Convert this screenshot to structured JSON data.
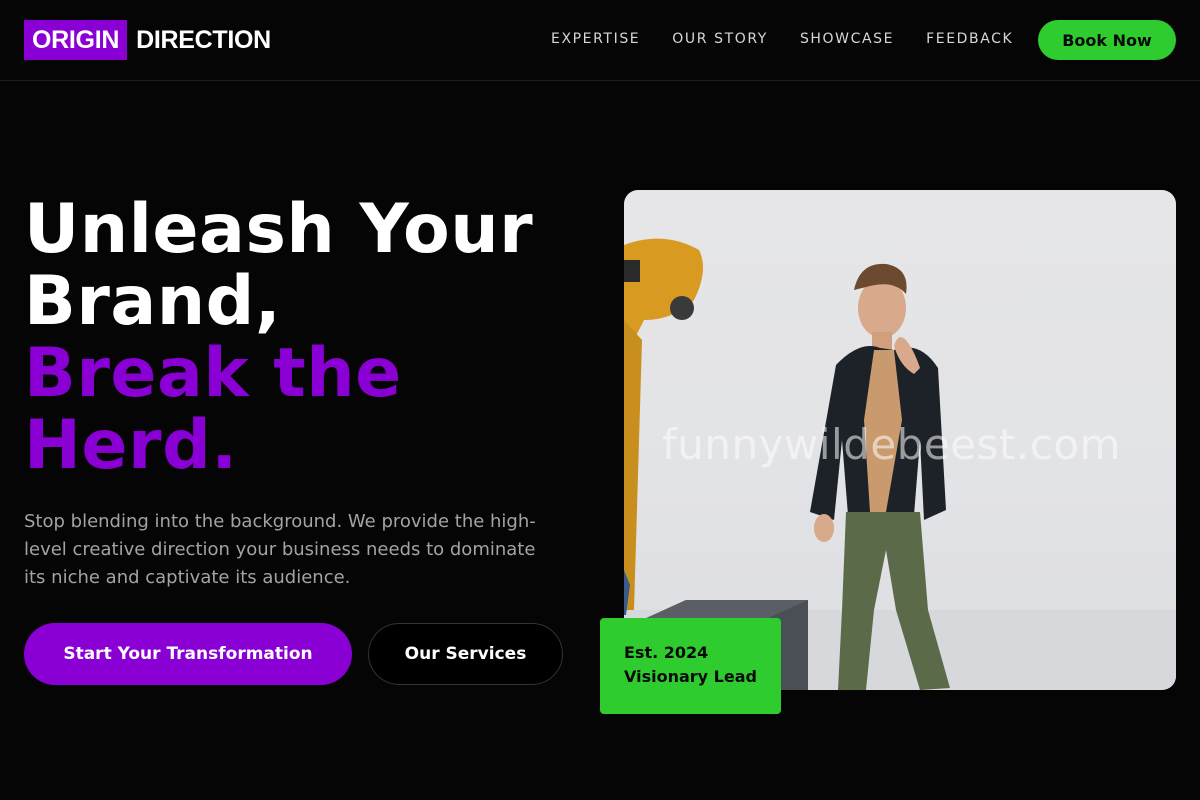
{
  "header": {
    "logo_box": "ORIGIN",
    "logo_text": "DIRECTION",
    "nav": [
      "EXPERTISE",
      "OUR STORY",
      "SHOWCASE",
      "FEEDBACK"
    ],
    "cta": "Book Now"
  },
  "hero": {
    "headline_line1": "Unleash Your",
    "headline_line2": "Brand,",
    "headline_accent1": "Break the",
    "headline_accent2": "Herd.",
    "subtext": "Stop blending into the background. We provide the high-level creative direction your business needs to dominate its niche and captivate its audience.",
    "primary_button": "Start Your Transformation",
    "secondary_button": "Our Services"
  },
  "photo": {
    "watermark": "funnywildebeest.com"
  },
  "badge": {
    "line1": "Est. 2024",
    "line2": "Visionary Lead"
  },
  "colors": {
    "background": "#050505",
    "accent_purple": "#8a00d4",
    "accent_green": "#2ecc2e",
    "muted_text": "#a3a3a3"
  }
}
